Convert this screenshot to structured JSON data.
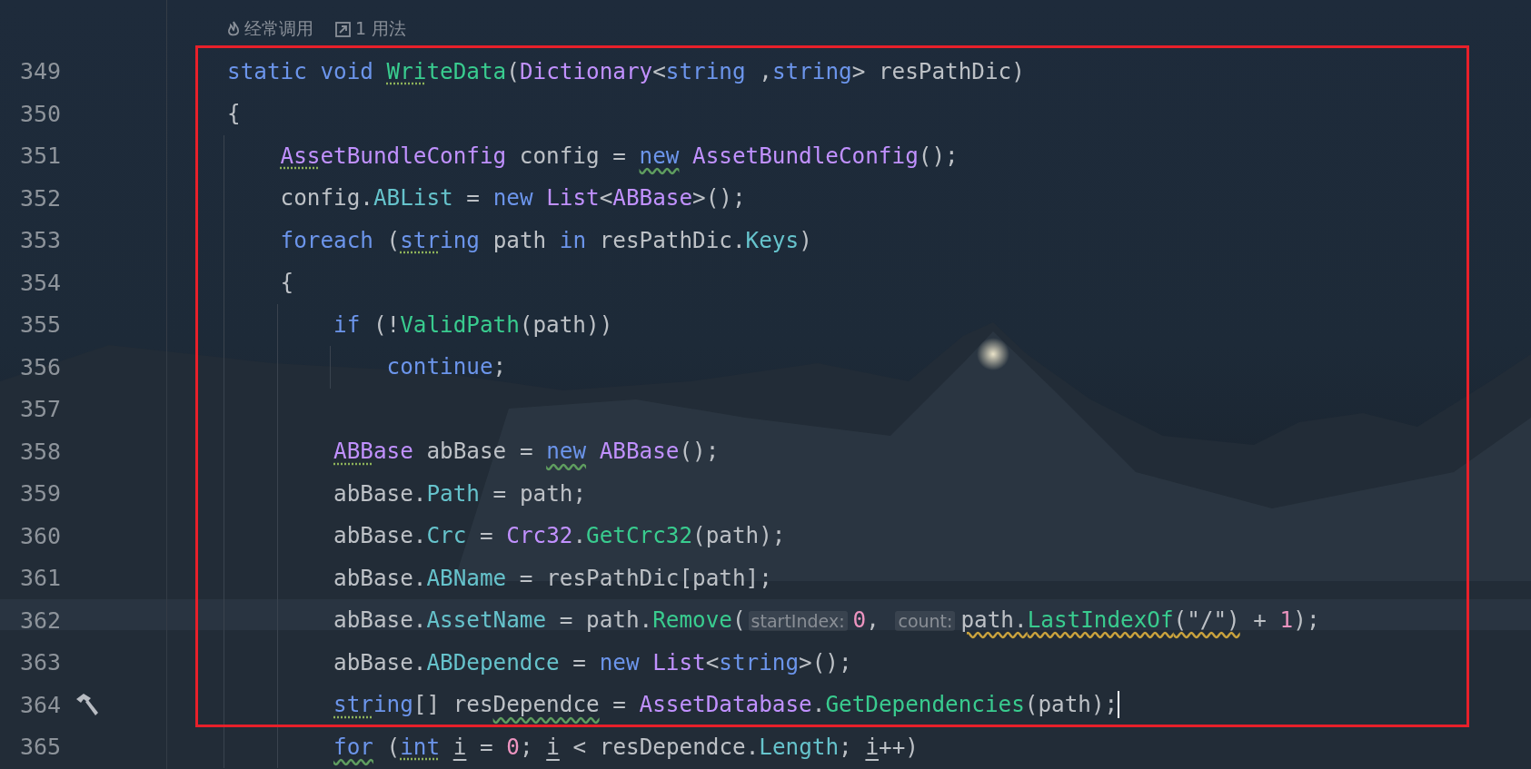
{
  "code_vision": [
    {
      "kind": "flame",
      "text": "经常调用"
    },
    {
      "kind": "usages",
      "text": "1 用法"
    }
  ],
  "highlight_box": true,
  "lines": [
    {
      "number": "349",
      "caret": false,
      "tokens": [
        {
          "t": "static",
          "kind": "kw"
        },
        {
          "t": "void",
          "kind": "kw",
          "spaced": true
        },
        {
          "t": "Wri",
          "kind": "fn",
          "spaced": true,
          "dotted_underline": true
        },
        {
          "t": "teData",
          "kind": "fn"
        },
        {
          "t": "(",
          "kind": "plain"
        },
        {
          "t": "Dictionary",
          "kind": "type"
        },
        {
          "t": "<",
          "kind": "plain"
        },
        {
          "t": "string",
          "kind": "kw"
        },
        {
          "t": ",",
          "kind": "plain",
          "spaced": true
        },
        {
          "t": "string",
          "kind": "kw"
        },
        {
          "t": ">",
          "kind": "plain"
        },
        {
          "t": "resPathDic)",
          "kind": "plain",
          "spaced": true
        }
      ]
    },
    {
      "number": "350",
      "caret": false,
      "tokens": [
        {
          "t": "{",
          "kind": "plain"
        }
      ],
      "children": [
        {
          "number": "351",
          "caret": false,
          "tokens": [
            {
              "t": "Ass",
              "kind": "type",
              "dotted_underline": true
            },
            {
              "t": "etBundleConfig",
              "kind": "type"
            },
            {
              "t": "config",
              "kind": "plain",
              "spaced": true
            },
            {
              "t": "=",
              "kind": "plain",
              "spaced": true
            },
            {
              "t": "new",
              "kind": "kw",
              "spaced": true,
              "wavy_underline": true
            },
            {
              "t": "AssetBundleConfig",
              "kind": "type",
              "spaced": true
            },
            {
              "t": "();",
              "kind": "plain"
            }
          ]
        },
        {
          "number": "352",
          "caret": false,
          "tokens": [
            {
              "t": "config.",
              "kind": "plain"
            },
            {
              "t": "ABList",
              "kind": "field"
            },
            {
              "t": "=",
              "kind": "plain",
              "spaced": true
            },
            {
              "t": "new",
              "kind": "kw",
              "spaced": true
            },
            {
              "t": "List",
              "kind": "type",
              "spaced": true
            },
            {
              "t": "<",
              "kind": "plain"
            },
            {
              "t": "ABBase",
              "kind": "type"
            },
            {
              "t": ">();",
              "kind": "plain"
            }
          ]
        },
        {
          "number": "353",
          "caret": false,
          "tokens": [
            {
              "t": "foreach",
              "kind": "kw"
            },
            {
              "t": "(",
              "kind": "plain",
              "spaced": true
            },
            {
              "t": "str",
              "kind": "kw",
              "dotted_underline": true
            },
            {
              "t": "ing",
              "kind": "kw"
            },
            {
              "t": "path",
              "kind": "plain",
              "spaced": true
            },
            {
              "t": "in",
              "kind": "kw",
              "spaced": true
            },
            {
              "t": "resPathDic.",
              "kind": "plain",
              "spaced": true
            },
            {
              "t": "Keys",
              "kind": "field"
            },
            {
              "t": ")",
              "kind": "plain"
            }
          ]
        },
        {
          "number": "354",
          "caret": false,
          "tokens": [
            {
              "t": "{",
              "kind": "plain"
            }
          ],
          "children": [
            {
              "number": "355",
              "caret": false,
              "tokens": [
                {
                  "t": "if",
                  "kind": "kw"
                },
                {
                  "t": "(!",
                  "kind": "plain",
                  "spaced": true
                },
                {
                  "t": "ValidPath",
                  "kind": "fn"
                },
                {
                  "t": "(path))",
                  "kind": "plain"
                }
              ],
              "children": [
                {
                  "number": "356",
                  "caret": false,
                  "tokens": [
                    {
                      "t": "continue",
                      "kind": "kw"
                    },
                    {
                      "t": ";",
                      "kind": "plain"
                    }
                  ]
                }
              ]
            },
            {
              "number": "357",
              "caret": false
            },
            {
              "number": "358",
              "caret": false,
              "tokens": [
                {
                  "t": "ABB",
                  "kind": "type",
                  "dotted_underline": true
                },
                {
                  "t": "ase",
                  "kind": "type"
                },
                {
                  "t": "abBase",
                  "kind": "plain",
                  "spaced": true
                },
                {
                  "t": "=",
                  "kind": "plain",
                  "spaced": true
                },
                {
                  "t": "new",
                  "kind": "kw",
                  "spaced": true,
                  "wavy_underline": true
                },
                {
                  "t": "ABBase",
                  "kind": "type",
                  "spaced": true
                },
                {
                  "t": "();",
                  "kind": "plain"
                }
              ]
            },
            {
              "number": "359",
              "caret": false,
              "tokens": [
                {
                  "t": "abBase.",
                  "kind": "plain"
                },
                {
                  "t": "Path",
                  "kind": "field"
                },
                {
                  "t": "=",
                  "kind": "plain",
                  "spaced": true
                },
                {
                  "t": "path;",
                  "kind": "plain",
                  "spaced": true
                }
              ]
            },
            {
              "number": "360",
              "caret": false,
              "tokens": [
                {
                  "t": "abBase.",
                  "kind": "plain"
                },
                {
                  "t": "Crc",
                  "kind": "field"
                },
                {
                  "t": "=",
                  "kind": "plain",
                  "spaced": true
                },
                {
                  "t": "Crc32",
                  "kind": "type",
                  "spaced": true
                },
                {
                  "t": ".",
                  "kind": "plain"
                },
                {
                  "t": "GetCrc32",
                  "kind": "fn"
                },
                {
                  "t": "(path);",
                  "kind": "plain"
                }
              ]
            },
            {
              "number": "361",
              "caret": false,
              "tokens": [
                {
                  "t": "abBase.",
                  "kind": "plain"
                },
                {
                  "t": "ABName",
                  "kind": "field"
                },
                {
                  "t": "=",
                  "kind": "plain",
                  "spaced": true
                },
                {
                  "t": "resPathDic[path];",
                  "kind": "plain",
                  "spaced": true
                }
              ]
            },
            {
              "number": "362",
              "caret": false,
              "tokens": [
                {
                  "t": "abBase.",
                  "kind": "plain"
                },
                {
                  "t": "AssetName",
                  "kind": "field"
                },
                {
                  "t": "=",
                  "kind": "plain",
                  "spaced": true
                },
                {
                  "t": "path.",
                  "kind": "plain",
                  "spaced": true
                },
                {
                  "t": "Remove",
                  "kind": "fn"
                },
                {
                  "t": "(",
                  "kind": "plain"
                },
                {
                  "t": "startIndex:",
                  "kind": "hint"
                },
                {
                  "t": "0",
                  "kind": "num"
                },
                {
                  "t": ",",
                  "kind": "plain"
                },
                {
                  "t": "count:",
                  "kind": "hint",
                  "spaced": true
                },
                {
                  "t": "path.",
                  "kind": "plain",
                  "warning_underline": true
                },
                {
                  "t": "LastIndexOf",
                  "kind": "fn",
                  "warning_underline": true
                },
                {
                  "t": "(\"/\")",
                  "kind": "plain",
                  "warning_underline": true
                },
                {
                  "t": "+",
                  "kind": "plain",
                  "spaced": true
                },
                {
                  "t": "1",
                  "kind": "num",
                  "spaced": true
                },
                {
                  "t": ");",
                  "kind": "plain"
                }
              ]
            },
            {
              "number": "363",
              "caret": false,
              "tokens": [
                {
                  "t": "abBase.",
                  "kind": "plain"
                },
                {
                  "t": "ABDependce",
                  "kind": "field"
                },
                {
                  "t": "=",
                  "kind": "plain",
                  "spaced": true
                },
                {
                  "t": "new",
                  "kind": "kw",
                  "spaced": true
                },
                {
                  "t": "List",
                  "kind": "type",
                  "spaced": true
                },
                {
                  "t": "<",
                  "kind": "plain"
                },
                {
                  "t": "string",
                  "kind": "kw"
                },
                {
                  "t": ">();",
                  "kind": "plain"
                }
              ]
            },
            {
              "number": "364",
              "caret": true,
              "build_marker": true,
              "tokens": [
                {
                  "t": "str",
                  "kind": "kw",
                  "dotted_underline": true
                },
                {
                  "t": "ing",
                  "kind": "kw"
                },
                {
                  "t": "[]",
                  "kind": "plain"
                },
                {
                  "t": "res",
                  "kind": "plain",
                  "spaced": true
                },
                {
                  "t": "Dependce",
                  "kind": "plain",
                  "wavy_underline": true
                },
                {
                  "t": "=",
                  "kind": "plain",
                  "spaced": true
                },
                {
                  "t": "AssetDatabase",
                  "kind": "type",
                  "spaced": true
                },
                {
                  "t": ".",
                  "kind": "plain"
                },
                {
                  "t": "GetDependencies",
                  "kind": "fn"
                },
                {
                  "t": "(path);",
                  "kind": "plain"
                }
              ]
            },
            {
              "number": "365",
              "caret": false,
              "tokens": [
                {
                  "t": "for",
                  "kind": "kw",
                  "wavy_underline": true
                },
                {
                  "t": "(",
                  "kind": "plain",
                  "spaced": true
                },
                {
                  "t": "int",
                  "kind": "kw",
                  "dotted_underline": true
                },
                {
                  "t": "i",
                  "kind": "plain",
                  "spaced": true,
                  "underline": true
                },
                {
                  "t": "=",
                  "kind": "plain",
                  "spaced": true
                },
                {
                  "t": "0",
                  "kind": "num",
                  "spaced": true
                },
                {
                  "t": ";",
                  "kind": "plain"
                },
                {
                  "t": "i",
                  "kind": "plain",
                  "spaced": true,
                  "underline": true
                },
                {
                  "t": "<",
                  "kind": "plain",
                  "spaced": true
                },
                {
                  "t": "resDependce.",
                  "kind": "plain",
                  "spaced": true
                },
                {
                  "t": "Length",
                  "kind": "field"
                },
                {
                  "t": ";",
                  "kind": "plain"
                },
                {
                  "t": "i",
                  "kind": "plain",
                  "spaced": true,
                  "underline": true
                },
                {
                  "t": "++)",
                  "kind": "plain"
                }
              ]
            }
          ]
        }
      ]
    }
  ]
}
